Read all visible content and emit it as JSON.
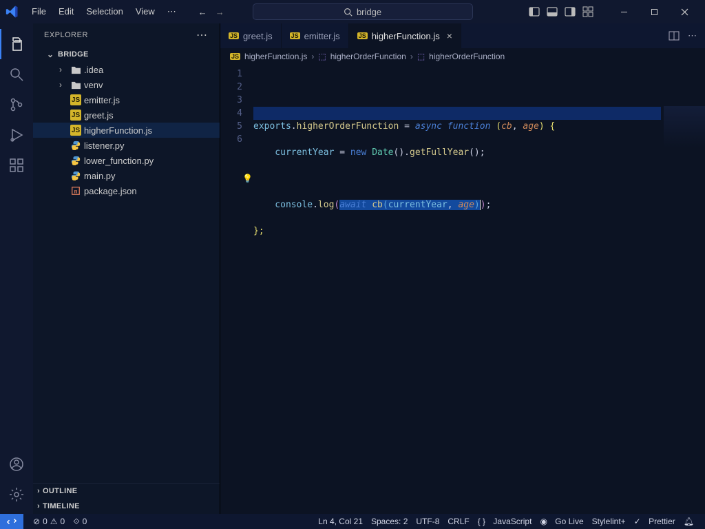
{
  "menu": {
    "file": "File",
    "edit": "Edit",
    "selection": "Selection",
    "view": "View"
  },
  "search": {
    "text": "bridge"
  },
  "explorer": {
    "title": "EXPLORER",
    "project": "BRIDGE",
    "sections": {
      "outline": "OUTLINE",
      "timeline": "TIMELINE"
    },
    "tree": {
      "idea": ".idea",
      "venv": "venv",
      "emitter": "emitter.js",
      "greet": "greet.js",
      "higher": "higherFunction.js",
      "listener": "listener.py",
      "lower": "lower_function.py",
      "main": "main.py",
      "package": "package.json"
    }
  },
  "tabs": {
    "greet": "greet.js",
    "emitter": "emitter.js",
    "higher": "higherFunction.js"
  },
  "breadcrumb": {
    "file": "higherFunction.js",
    "sym1": "higherOrderFunction",
    "sym2": "higherOrderFunction"
  },
  "code": {
    "l1a": "exports",
    "l1b": ".",
    "l1c": "higherOrderFunction",
    "l1d": " = ",
    "l1e": "async",
    "l1f": " ",
    "l1g": "function",
    "l1h": " (",
    "l1i": "cb",
    "l1j": ", ",
    "l1k": "age",
    "l1l": ") {",
    "l2a": "    currentYear",
    "l2b": " = ",
    "l2c": "new",
    "l2d": " ",
    "l2e": "Date",
    "l2f": "().",
    "l2g": "getFullYear",
    "l2h": "();",
    "l4a": "    console",
    "l4b": ".",
    "l4c": "log",
    "l4d": "(",
    "l4e": "await",
    "l4f": " ",
    "l4g": "cb",
    "l4h": "(",
    "l4i": "currentYear",
    "l4j": ", ",
    "l4k": "age",
    "l4l": ")",
    "l4m": ")",
    "l4n": ";",
    "l5a": "};"
  },
  "gutter": {
    "l1": "1",
    "l2": "2",
    "l3": "3",
    "l4": "4",
    "l5": "5",
    "l6": "6"
  },
  "status": {
    "errors": "0",
    "warnings": "0",
    "ports": "0",
    "ln": "Ln 4, Col 21",
    "spaces": "Spaces: 2",
    "enc": "UTF-8",
    "eol": "CRLF",
    "lang": "JavaScript",
    "golive": "Go Live",
    "stylelint": "Stylelint+",
    "prettier": "Prettier"
  }
}
